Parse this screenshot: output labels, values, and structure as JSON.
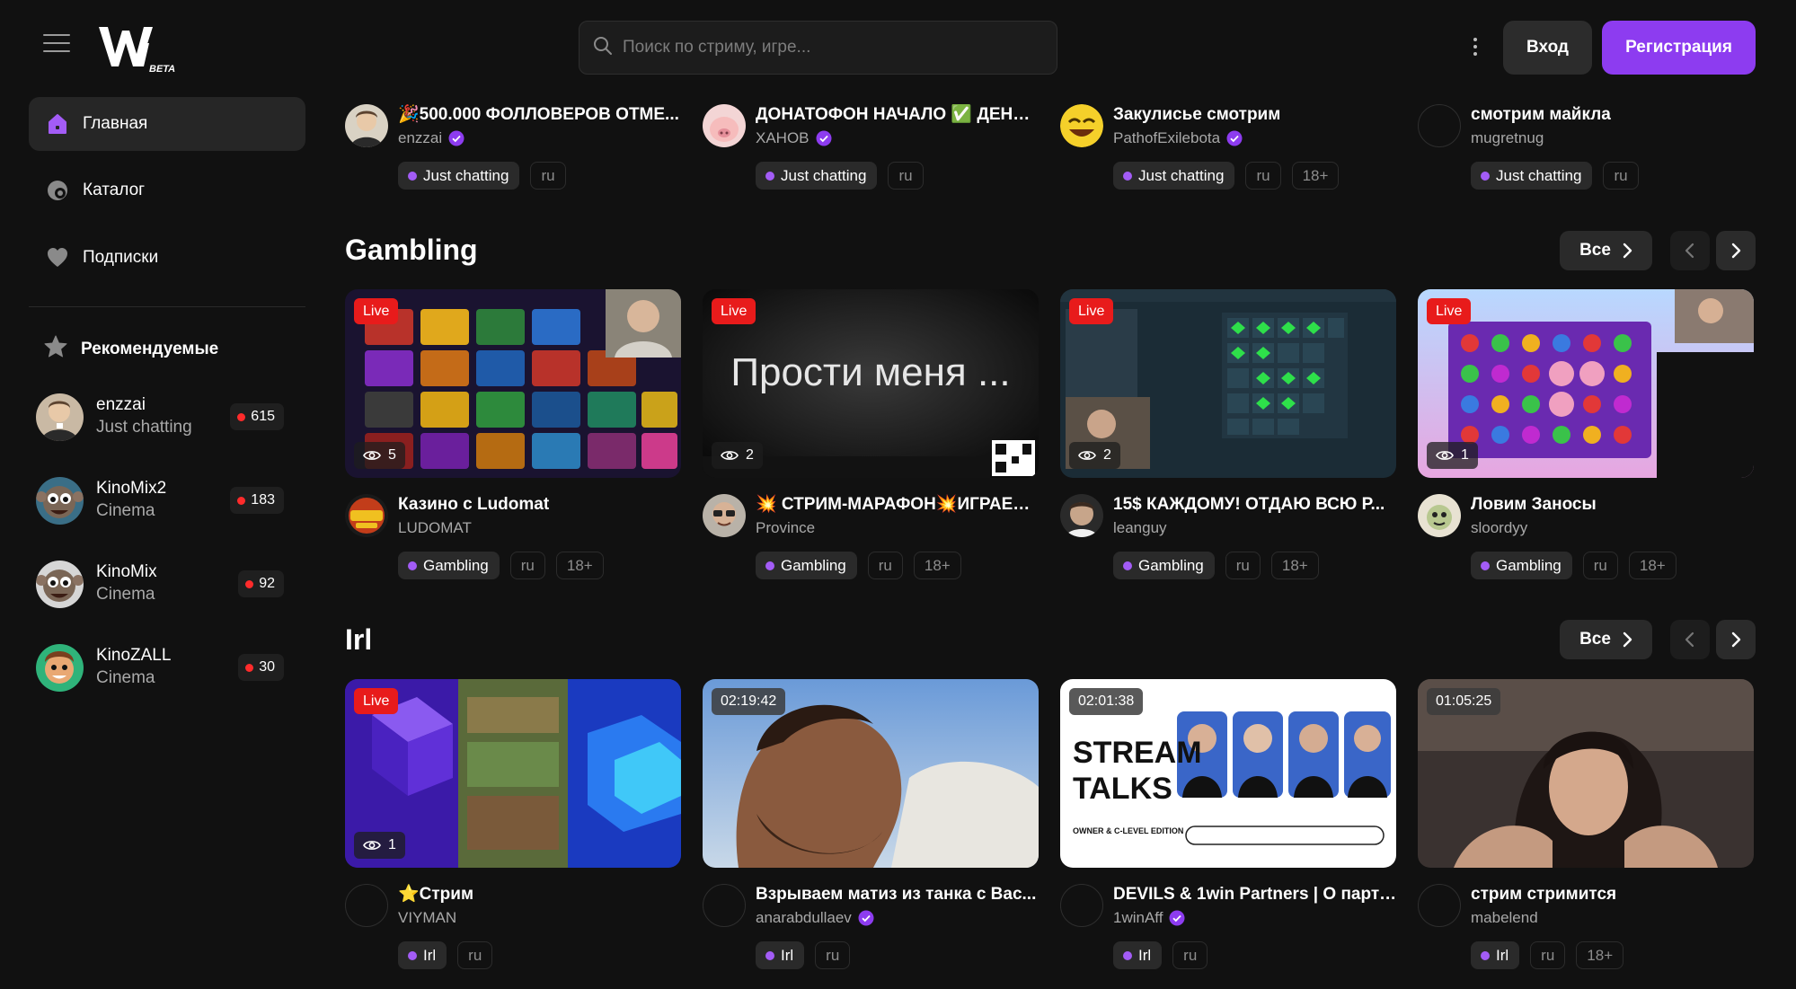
{
  "header": {
    "logo_text": "W",
    "logo_badge": "BETA",
    "search_placeholder": "Поиск по стриму, игре...",
    "login_label": "Вход",
    "register_label": "Регистрация"
  },
  "sidebar": {
    "nav": [
      {
        "label": "Главная",
        "icon": "home-icon"
      },
      {
        "label": "Каталог",
        "icon": "catalog-icon"
      },
      {
        "label": "Подписки",
        "icon": "heart-icon"
      }
    ],
    "recommended_title": "Рекомендуемые",
    "recommended": [
      {
        "name": "enzzai",
        "category": "Just chatting",
        "viewers": "615"
      },
      {
        "name": "KinoMix2",
        "category": "Cinema",
        "viewers": "183"
      },
      {
        "name": "KinoMix",
        "category": "Cinema",
        "viewers": "92"
      },
      {
        "name": "KinoZALL",
        "category": "Cinema",
        "viewers": "30"
      }
    ]
  },
  "top_row": [
    {
      "title": "🎉500.000 ФОЛЛОВЕРОВ ОТМЕ...",
      "channel": "enzzai",
      "verified": true,
      "tags": [
        "Just chatting",
        "ru"
      ]
    },
    {
      "title": "ДОНАТОФОН НАЧАЛО ✅ ДЕНЬ ...",
      "channel": "ХАНОВ",
      "verified": true,
      "tags": [
        "Just chatting",
        "ru"
      ]
    },
    {
      "title": "Закулисье смотрим",
      "channel": "PathofExilebota",
      "verified": true,
      "tags": [
        "Just chatting",
        "ru",
        "18+"
      ]
    },
    {
      "title": "смотрим майкла",
      "channel": "mugretnug",
      "verified": false,
      "tags": [
        "Just chatting",
        "ru"
      ]
    }
  ],
  "sections": [
    {
      "title": "Gambling",
      "all_label": "Все",
      "cards": [
        {
          "badge": "Live",
          "viewers": "5",
          "thumb_text": "",
          "title": "Казино с Ludomat",
          "channel": "LUDOMAT",
          "verified": false,
          "tags": [
            "Gambling",
            "ru",
            "18+"
          ]
        },
        {
          "badge": "Live",
          "viewers": "2",
          "thumb_text": "Прости меня ...",
          "title": "💥 СТРИМ-МАРАФОН💥ИГРАЕМ ...",
          "channel": "Province",
          "verified": false,
          "tags": [
            "Gambling",
            "ru",
            "18+"
          ]
        },
        {
          "badge": "Live",
          "viewers": "2",
          "thumb_text": "",
          "title": "15$ КАЖДОМУ! ОТДАЮ ВСЮ Р...",
          "channel": "leanguy",
          "verified": false,
          "tags": [
            "Gambling",
            "ru",
            "18+"
          ]
        },
        {
          "badge": "Live",
          "viewers": "1",
          "thumb_text": "",
          "title": "Ловим Заносы",
          "channel": "sloordyy",
          "verified": false,
          "tags": [
            "Gambling",
            "ru",
            "18+"
          ]
        }
      ]
    },
    {
      "title": "Irl",
      "all_label": "Все",
      "cards": [
        {
          "badge": "Live",
          "viewers": "1",
          "thumb_text": "",
          "title": "⭐Стрим",
          "channel": "VIYMAN",
          "verified": false,
          "tags": [
            "Irl",
            "ru"
          ]
        },
        {
          "badge": "02:19:42",
          "viewers": "",
          "thumb_text": "",
          "title": "Взрываем матиз из танка с Вас...",
          "channel": "anarabdullaev",
          "verified": true,
          "tags": [
            "Irl",
            "ru"
          ]
        },
        {
          "badge": "02:01:38",
          "viewers": "",
          "thumb_text": "STREAM TALKS",
          "title": "DEVILS & 1win Partners | О партн...",
          "channel": "1winAff",
          "verified": true,
          "tags": [
            "Irl",
            "ru"
          ]
        },
        {
          "badge": "01:05:25",
          "viewers": "",
          "thumb_text": "",
          "title": "стрим стримится",
          "channel": "mabelend",
          "verified": false,
          "tags": [
            "Irl",
            "ru",
            "18+"
          ]
        }
      ]
    }
  ],
  "colors": {
    "accent": "#8d3cf0",
    "live": "#e81b1b",
    "background": "#111111"
  }
}
